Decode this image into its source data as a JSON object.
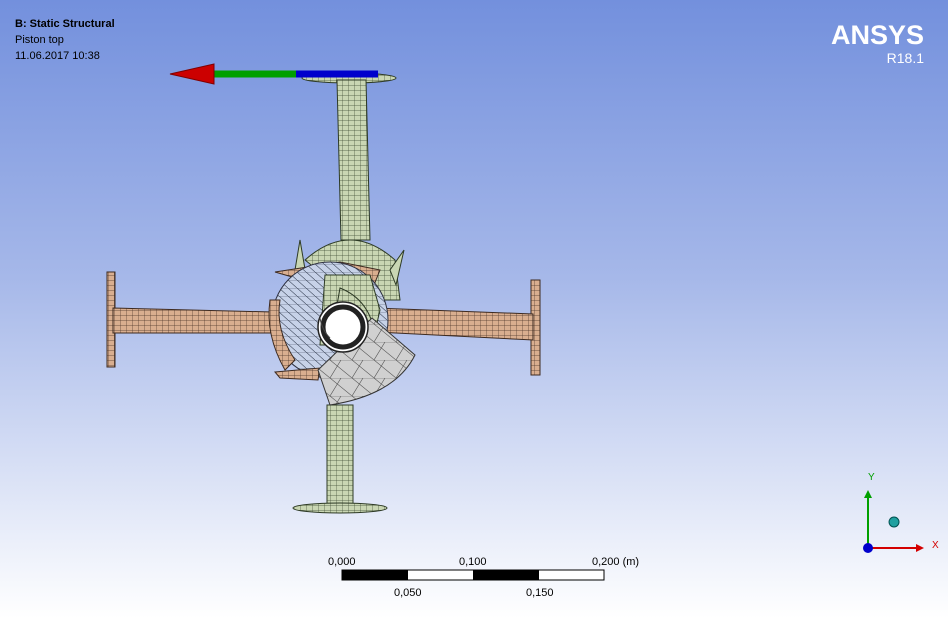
{
  "header": {
    "analysis_title": "B: Static Structural",
    "result_name": "Piston top",
    "date": "11.06.2017 10:38"
  },
  "brand": {
    "name": "ANSYS",
    "version": "R18.1"
  },
  "scale_bar": {
    "top_labels": [
      "0,000",
      "0,100",
      "0,200 (m)"
    ],
    "bottom_labels": [
      "0,050",
      "0,150"
    ]
  },
  "triad": {
    "x_label": "X",
    "y_label": "Y"
  },
  "colors": {
    "mesh_green": "#c9d6b3",
    "mesh_tan": "#d9ae8f",
    "mesh_blue": "#c7d2e8",
    "mesh_gray": "#d0d0d0",
    "arrow_red": "#cc0000",
    "arrow_green": "#00a000",
    "arrow_blue": "#0000cc",
    "triad_x": "#d40000",
    "triad_y": "#00a000",
    "triad_z": "#0000cc",
    "triad_ball": "#20a0a0"
  }
}
